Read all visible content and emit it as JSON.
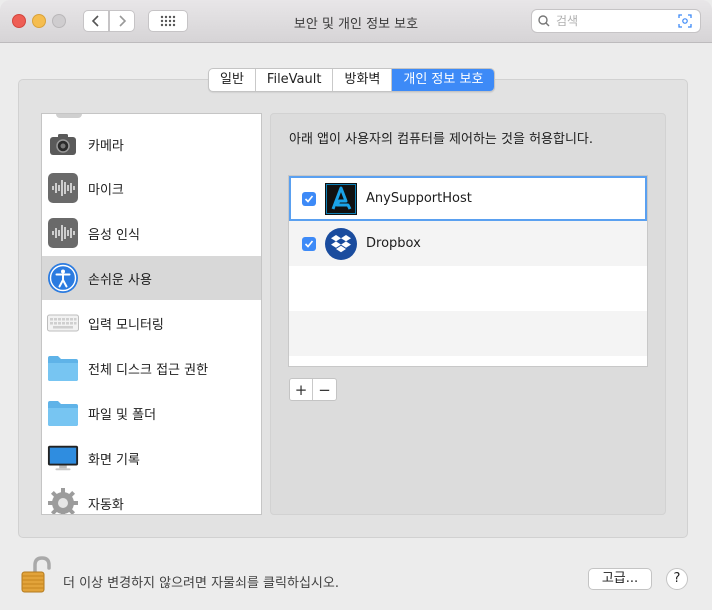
{
  "window": {
    "title": "보안 및 개인 정보 보호",
    "search_placeholder": "검색"
  },
  "tabs": [
    {
      "label": "일반",
      "active": false
    },
    {
      "label": "FileVault",
      "active": false
    },
    {
      "label": "방화벽",
      "active": false
    },
    {
      "label": "개인 정보 보호",
      "active": true
    }
  ],
  "sidebar": {
    "items": [
      {
        "label": "카메라",
        "icon": "camera-icon"
      },
      {
        "label": "마이크",
        "icon": "microphone-icon"
      },
      {
        "label": "음성 인식",
        "icon": "speech-recognition-icon"
      },
      {
        "label": "손쉬운 사용",
        "icon": "accessibility-icon",
        "selected": true
      },
      {
        "label": "입력 모니터링",
        "icon": "keyboard-icon"
      },
      {
        "label": "전체 디스크 접근 권한",
        "icon": "folder-icon"
      },
      {
        "label": "파일 및 폴더",
        "icon": "folder-icon"
      },
      {
        "label": "화면 기록",
        "icon": "display-icon"
      },
      {
        "label": "자동화",
        "icon": "gear-icon"
      }
    ]
  },
  "content": {
    "description": "아래 앱이 사용자의 컴퓨터를 제어하는 것을 허용합니다.",
    "apps": [
      {
        "name": "AnySupportHost",
        "checked": true,
        "icon": "anysupport-icon"
      },
      {
        "name": "Dropbox",
        "checked": true,
        "icon": "dropbox-icon"
      }
    ],
    "add_label": "+",
    "remove_label": "−"
  },
  "footer": {
    "lock_text": "더 이상 변경하지 않으려면 자물쇠를 클릭하십시오.",
    "advanced_label": "고급...",
    "help_label": "?"
  },
  "colors": {
    "accent": "#3d8af7",
    "dropbox": "#1a4c9e",
    "anysupport": "#0f7fb4"
  }
}
